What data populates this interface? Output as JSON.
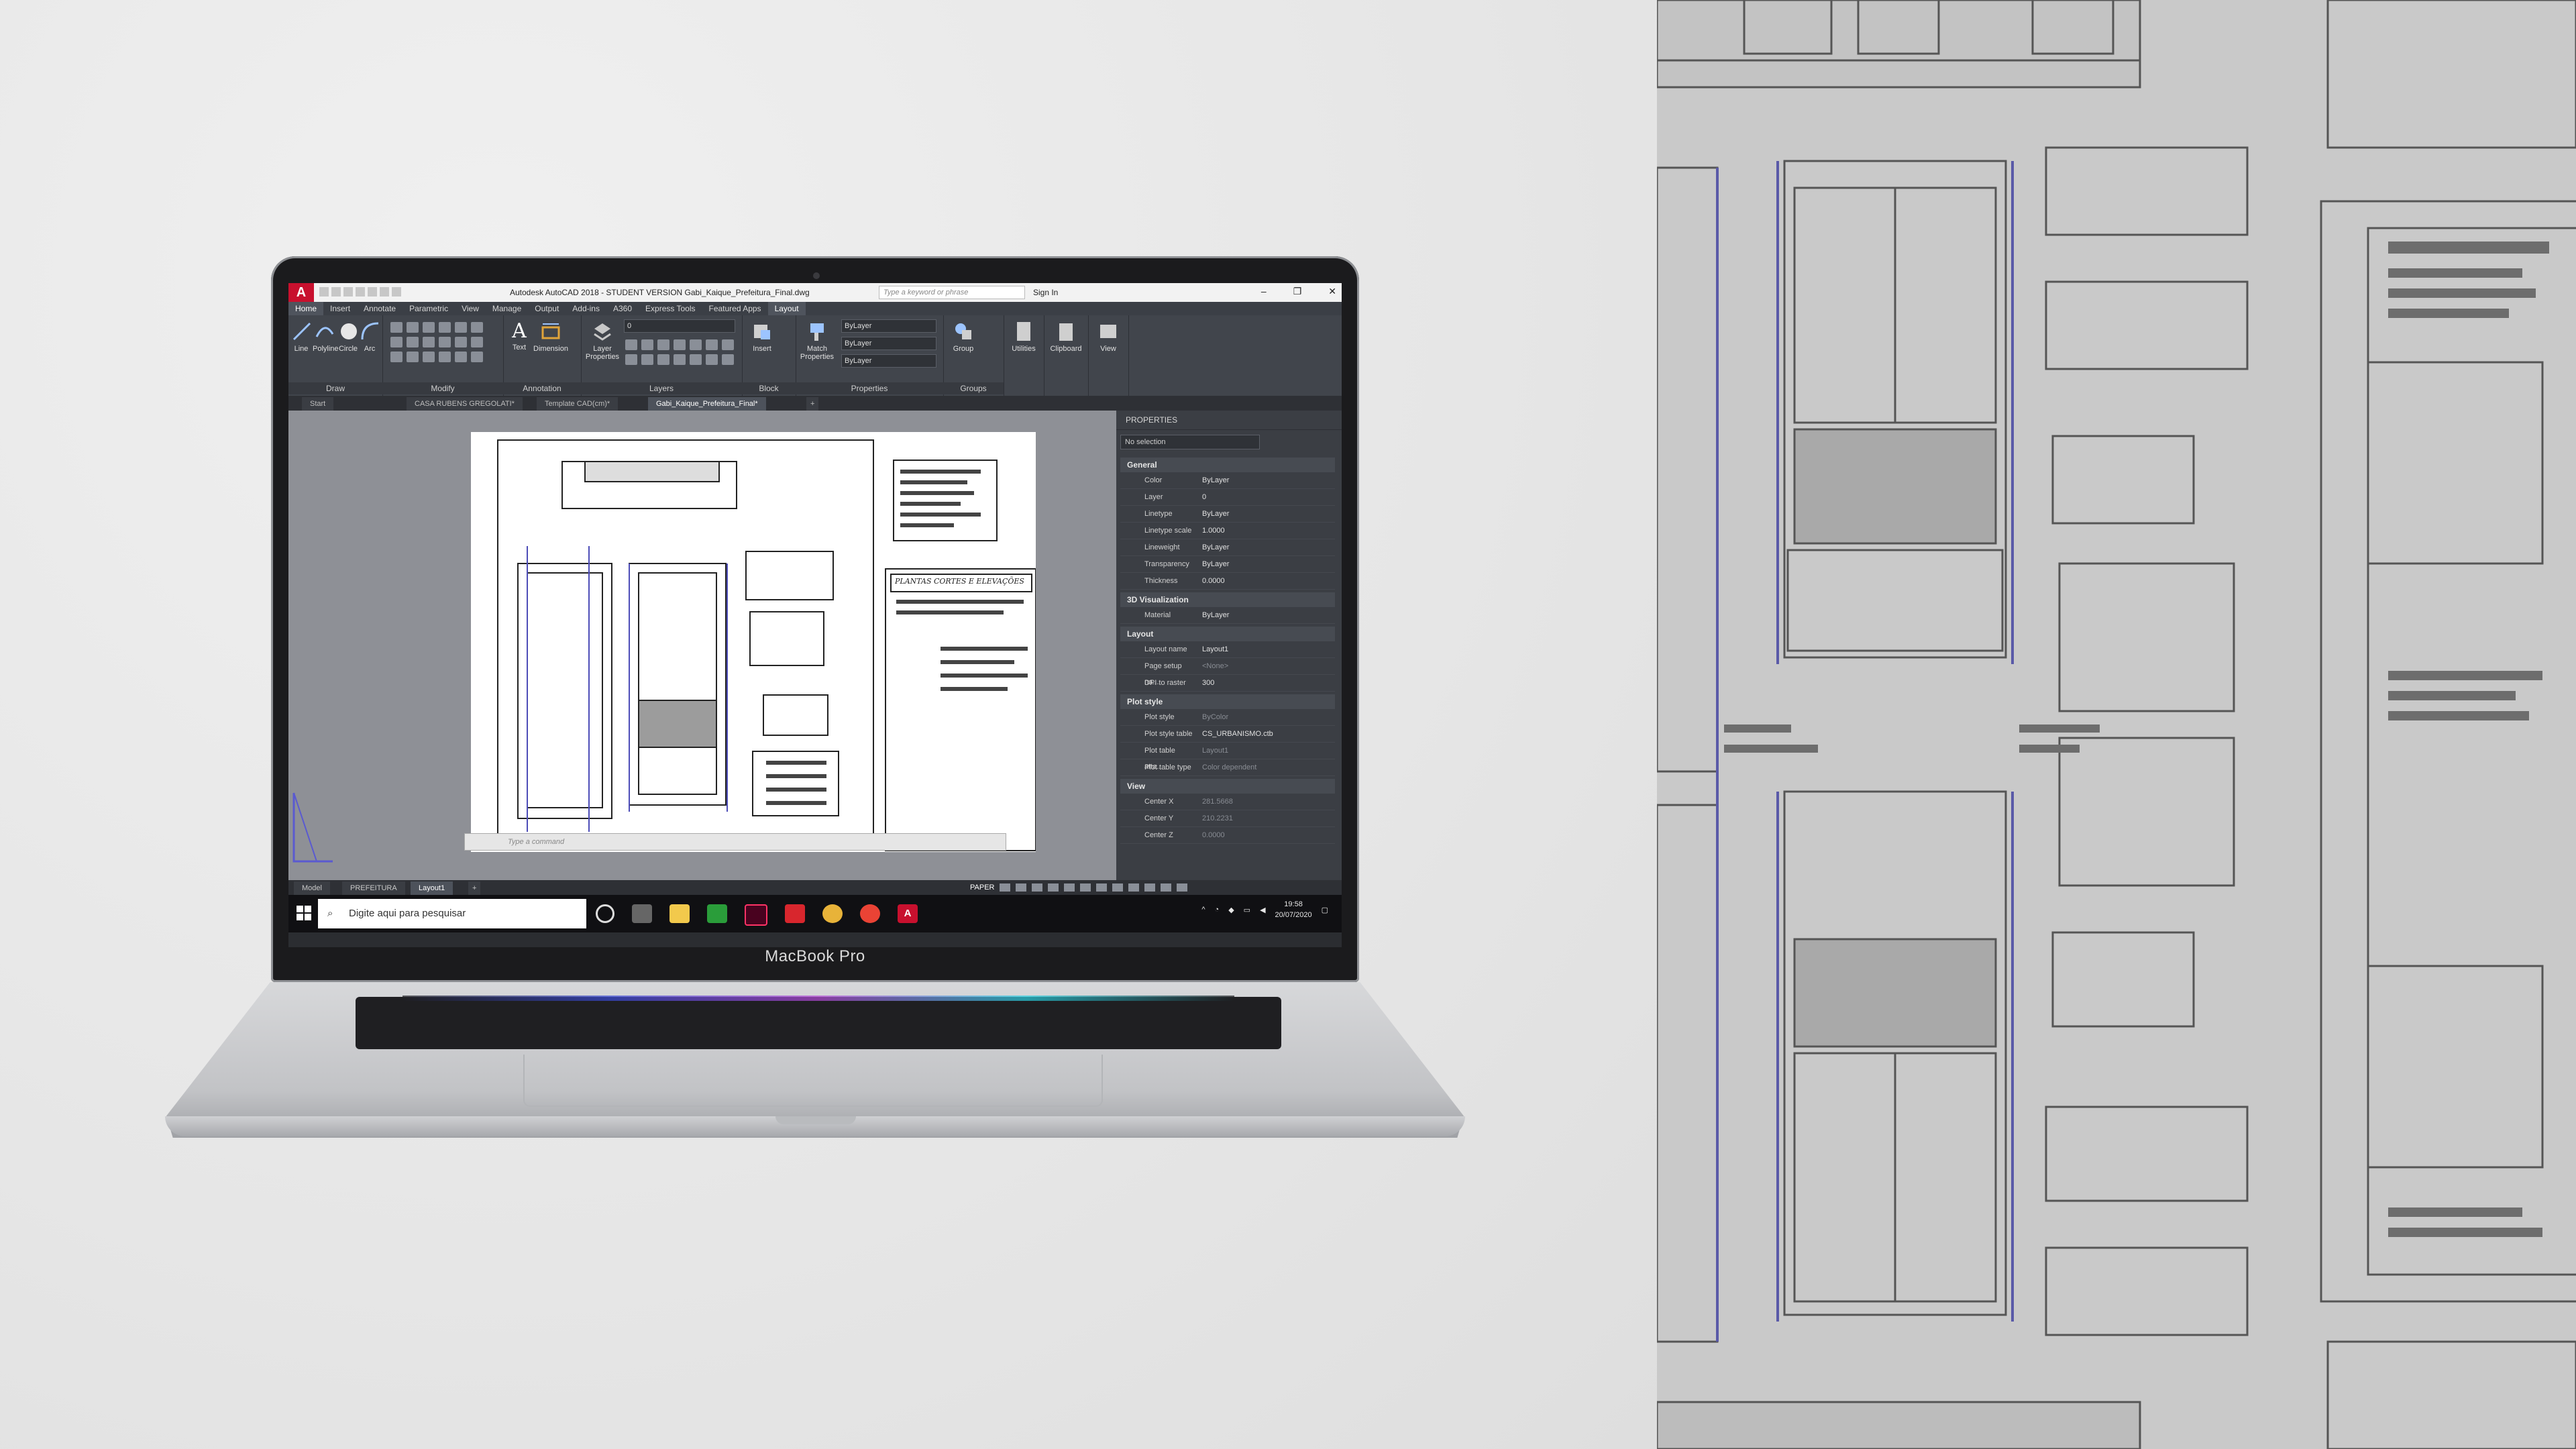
{
  "autocad": {
    "window_title": "Autodesk AutoCAD 2018 - STUDENT VERSION   Gabi_Kaique_Prefeitura_Final.dwg",
    "search_placeholder": "Type a keyword or phrase",
    "sign_in": "Sign In",
    "menu_tabs": [
      "Home",
      "Insert",
      "Annotate",
      "Parametric",
      "View",
      "Manage",
      "Output",
      "Add-ins",
      "A360",
      "Express Tools",
      "Featured Apps",
      "Layout"
    ],
    "ribbon": {
      "draw": {
        "label": "Draw",
        "buttons": [
          "Line",
          "Polyline",
          "Circle",
          "Arc"
        ]
      },
      "modify": {
        "label": "Modify"
      },
      "annotation": {
        "label": "Annotation",
        "buttons": [
          "Text",
          "Dimension"
        ]
      },
      "layers": {
        "label": "Layers",
        "button": "Layer Properties",
        "layer_value": "0"
      },
      "block": {
        "label": "Block",
        "button": "Insert"
      },
      "properties": {
        "label": "Properties",
        "button": "Match Properties",
        "values": [
          "ByLayer",
          "ByLayer",
          "ByLayer"
        ]
      },
      "groups": {
        "label": "Groups",
        "button": "Group"
      },
      "utilities": "Utilities",
      "clipboard": "Clipboard",
      "view": "View"
    },
    "doc_tabs": [
      "Start",
      "CASA RUBENS GREGOLATI*",
      "Template CAD(cm)*",
      "Gabi_Kaique_Prefeitura_Final*"
    ],
    "active_doc_tab": "Gabi_Kaique_Prefeitura_Final*",
    "command_placeholder": "Type a command",
    "sheet_title": "PLANTAS CORTES E ELEVAÇÕES",
    "properties_palette": {
      "title": "PROPERTIES",
      "selection": "No selection",
      "sections": [
        {
          "name": "General",
          "rows": [
            {
              "k": "Color",
              "v": "ByLayer"
            },
            {
              "k": "Layer",
              "v": "0"
            },
            {
              "k": "Linetype",
              "v": "ByLayer"
            },
            {
              "k": "Linetype scale",
              "v": "1.0000"
            },
            {
              "k": "Lineweight",
              "v": "ByLayer"
            },
            {
              "k": "Transparency",
              "v": "ByLayer"
            },
            {
              "k": "Thickness",
              "v": "0.0000"
            }
          ]
        },
        {
          "name": "3D Visualization",
          "rows": [
            {
              "k": "Material",
              "v": "ByLayer"
            }
          ]
        },
        {
          "name": "Layout",
          "rows": [
            {
              "k": "Layout name",
              "v": "Layout1"
            },
            {
              "k": "Page setup na...",
              "v": "<None>"
            },
            {
              "k": "DPI to raster",
              "v": "300"
            }
          ]
        },
        {
          "name": "Plot style",
          "rows": [
            {
              "k": "Plot style",
              "v": "ByColor"
            },
            {
              "k": "Plot style table",
              "v": "CS_URBANISMO.ctb"
            },
            {
              "k": "Plot table atta...",
              "v": "Layout1"
            },
            {
              "k": "Plot table type",
              "v": "Color dependent"
            }
          ]
        },
        {
          "name": "View",
          "rows": [
            {
              "k": "Center X",
              "v": "281.5668"
            },
            {
              "k": "Center Y",
              "v": "210.2231"
            },
            {
              "k": "Center Z",
              "v": "0.0000"
            }
          ]
        }
      ]
    },
    "layout_tabs": [
      "Model",
      "PREFEITURA",
      "Layout1"
    ],
    "active_layout_tab": "Layout1",
    "status_paper": "PAPER"
  },
  "taskbar": {
    "search_placeholder": "Digite aqui para pesquisar",
    "time": "19:58",
    "date": "20/07/2020"
  },
  "laptop_label": "MacBook Pro",
  "colors": {
    "autocad_red": "#c8102e",
    "ribbon_bg": "#41454c",
    "taskbar_bg": "#101013"
  }
}
